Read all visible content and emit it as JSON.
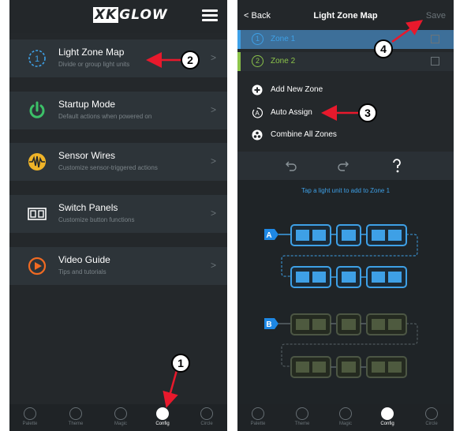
{
  "colors": {
    "accent_red": "#e8192c",
    "zone_blue": "#3ea0e6",
    "zone_green": "#8bc34a",
    "startup_green": "#3cc068",
    "video_orange": "#f06a22"
  },
  "left": {
    "logo": "XKGLOW",
    "menu": [
      {
        "title": "Light Zone Map",
        "subtitle": "Divide or group light units",
        "icon": "zone-map-icon"
      },
      {
        "title": "Startup Mode",
        "subtitle": "Default actions when powered on",
        "icon": "power-icon"
      },
      {
        "title": "Sensor Wires",
        "subtitle": "Customize sensor-triggered actions",
        "icon": "sensor-wires-icon"
      },
      {
        "title": "Switch Panels",
        "subtitle": "Customize button functions",
        "icon": "switch-panels-icon"
      },
      {
        "title": "Video Guide",
        "subtitle": "Tips and tutorials",
        "icon": "play-icon"
      }
    ],
    "chevron": ">",
    "tabs": [
      "Palette",
      "Theme",
      "Magic",
      "Config",
      "Circle"
    ],
    "active_tab": "Config"
  },
  "right": {
    "back_label": "Back",
    "back_glyph": "<",
    "title": "Light Zone Map",
    "save_label": "Save",
    "zones": [
      {
        "num": "1",
        "label": "Zone 1",
        "color": "#3ea0e6"
      },
      {
        "num": "2",
        "label": "Zone 2",
        "color": "#8bc34a"
      }
    ],
    "actions": [
      {
        "label": "Add New Zone",
        "icon": "plus-circle-icon"
      },
      {
        "label": "Auto Assign",
        "icon": "auto-assign-icon"
      },
      {
        "label": "Combine All Zones",
        "icon": "combine-icon"
      }
    ],
    "tools": [
      "undo-icon",
      "redo-icon",
      "help-icon"
    ],
    "hint": "Tap a light unit to add to Zone 1",
    "groups": [
      {
        "tag": "A",
        "state": "assigned"
      },
      {
        "tag": "B",
        "state": "unassigned"
      }
    ],
    "tabs": [
      "Palette",
      "Theme",
      "Magic",
      "Config",
      "Circle"
    ],
    "active_tab": "Config"
  },
  "callouts": [
    "1",
    "2",
    "3",
    "4"
  ]
}
